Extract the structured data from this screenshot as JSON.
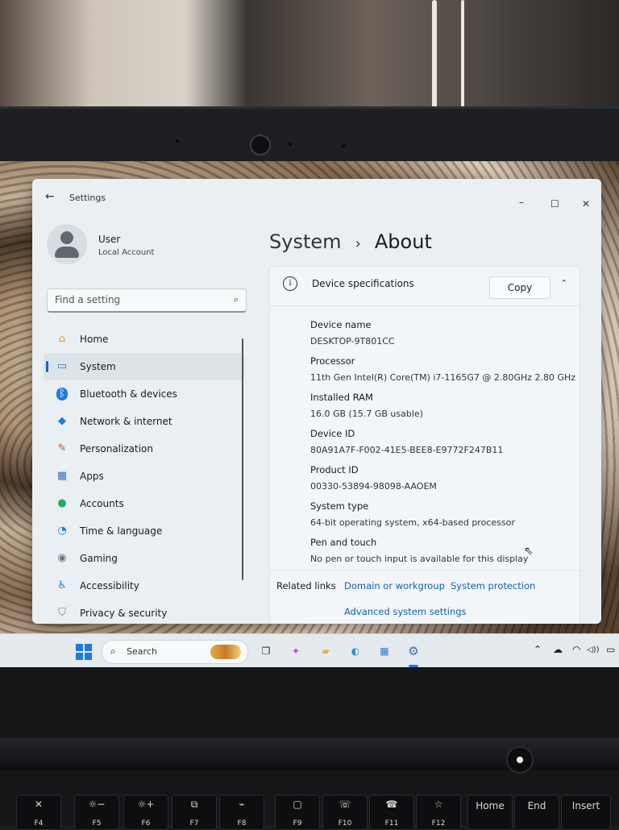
{
  "window": {
    "title": "Settings",
    "back_icon": "←",
    "minimize": "–",
    "maximize": "☐",
    "close": "✕"
  },
  "user": {
    "name": "User",
    "account_type": "Local Account"
  },
  "search": {
    "placeholder": "Find a setting",
    "icon": "⌕"
  },
  "nav": {
    "items": [
      {
        "label": "Home",
        "icon": "home-icon",
        "glyph": "⌂",
        "color": "#e8963c"
      },
      {
        "label": "System",
        "icon": "monitor-icon",
        "glyph": "▭",
        "color": "#1f7ae0"
      },
      {
        "label": "Bluetooth & devices",
        "icon": "bluetooth-icon",
        "glyph": "ᛒ",
        "color": "#1f7ae0"
      },
      {
        "label": "Network & internet",
        "icon": "wifi-icon",
        "glyph": "◆",
        "color": "#1f7ae0"
      },
      {
        "label": "Personalization",
        "icon": "brush-icon",
        "glyph": "✎",
        "color": "#c05a2a"
      },
      {
        "label": "Apps",
        "icon": "apps-icon",
        "glyph": "▦",
        "color": "#3b6fb4"
      },
      {
        "label": "Accounts",
        "icon": "accounts-icon",
        "glyph": "●",
        "color": "#2aa86a"
      },
      {
        "label": "Time & language",
        "icon": "globe-clock-icon",
        "glyph": "◔",
        "color": "#1f7ae0"
      },
      {
        "label": "Gaming",
        "icon": "gamepad-icon",
        "glyph": "◉",
        "color": "#6a7a88"
      },
      {
        "label": "Accessibility",
        "icon": "accessibility-icon",
        "glyph": "♿",
        "color": "#1f7ae0"
      },
      {
        "label": "Privacy & security",
        "icon": "shield-icon",
        "glyph": "⛉",
        "color": "#6a7a88"
      }
    ]
  },
  "breadcrumb": {
    "parent": "System",
    "separator": "›",
    "current": "About"
  },
  "specs": {
    "title": "Device specifications",
    "copy_label": "Copy",
    "collapse_icon": "⌃",
    "info_icon": "i",
    "rows": [
      {
        "label": "Device name",
        "value": "DESKTOP-9T801CC"
      },
      {
        "label": "Processor",
        "value": "11th Gen Intel(R) Core(TM) i7-1165G7 @ 2.80GHz   2.80 GHz"
      },
      {
        "label": "Installed RAM",
        "value": "16.0 GB (15.7 GB usable)"
      },
      {
        "label": "Device ID",
        "value": "80A91A7F-F002-41E5-BEE8-E9772F247B11"
      },
      {
        "label": "Product ID",
        "value": "00330-53894-98098-AAOEM"
      },
      {
        "label": "System type",
        "value": "64-bit operating system, x64-based processor"
      },
      {
        "label": "Pen and touch",
        "value": "No pen or touch input is available for this display"
      }
    ]
  },
  "related": {
    "label": "Related links",
    "link1": "Domain or workgroup",
    "link2": "System protection",
    "link3": "Advanced system settings"
  },
  "taskbar": {
    "search_label": "Search",
    "search_icon": "⌕",
    "apps": [
      {
        "name": "task-view-icon",
        "glyph": "❐",
        "color": "#2a2a2a"
      },
      {
        "name": "copilot-icon",
        "glyph": "✦",
        "color": "#b44fd0"
      },
      {
        "name": "file-explorer-icon",
        "glyph": "▰",
        "color": "#e8b23a"
      },
      {
        "name": "edge-icon",
        "glyph": "◐",
        "color": "#1a8fd0"
      },
      {
        "name": "store-icon",
        "glyph": "▦",
        "color": "#3a78c8"
      },
      {
        "name": "settings-gear-icon",
        "glyph": "⚙",
        "color": "#3a6fb0"
      }
    ],
    "tray": {
      "chevron": "⌃",
      "cloud": "☁",
      "wifi": "◠",
      "volume": "◁))",
      "battery": "▭"
    }
  },
  "keyboard": {
    "keys": [
      {
        "icon": "✕",
        "label": "F4",
        "name": "key-f4"
      },
      {
        "icon": "☼−",
        "label": "F5",
        "name": "key-f5"
      },
      {
        "icon": "☼+",
        "label": "F6",
        "name": "key-f6"
      },
      {
        "icon": "⧉",
        "label": "F7",
        "name": "key-f7"
      },
      {
        "icon": "⌁",
        "label": "F8",
        "name": "key-f8"
      },
      {
        "icon": "▢",
        "label": "F9",
        "name": "key-f9"
      },
      {
        "icon": "☏",
        "label": "F10",
        "name": "key-f10"
      },
      {
        "icon": "☎",
        "label": "F11",
        "name": "key-f11"
      },
      {
        "icon": "☆",
        "label": "F12",
        "name": "key-f12"
      },
      {
        "word": "Home",
        "name": "key-home"
      },
      {
        "word": "End",
        "name": "key-end"
      },
      {
        "word": "Insert",
        "name": "key-insert"
      }
    ]
  }
}
